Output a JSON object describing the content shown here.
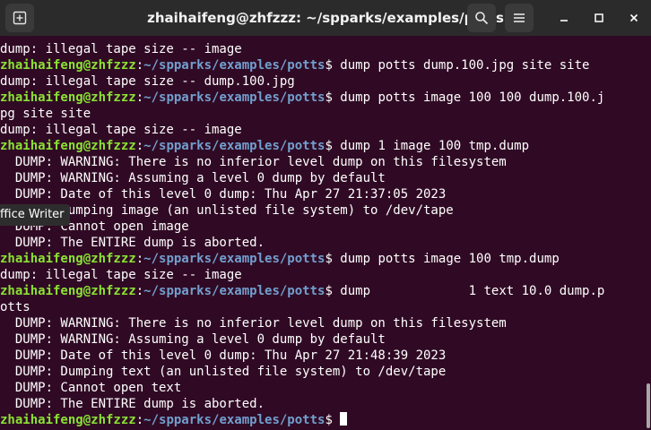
{
  "window": {
    "title": "zhaihaifeng@zhfzzz: ~/spparks/examples/potts"
  },
  "icons": {
    "new_tab": "new-tab-icon",
    "search": "search-icon",
    "menu": "hamburger-menu-icon",
    "minimize": "minimize-icon",
    "maximize": "maximize-icon",
    "close": "close-icon"
  },
  "colors": {
    "terminal_bg": "#300a24",
    "prompt_user": "#8ae234",
    "prompt_path": "#729fcf",
    "titlebar": "#2b2b2b"
  },
  "prompt": {
    "user": "zhaihaifeng@zhfzzz",
    "sep": ":",
    "path": "~/spparks/examples/potts",
    "symbol": "$"
  },
  "tooltip": {
    "text": "ffice Writer"
  },
  "terminal": {
    "lines": [
      "dump: illegal tape size -- image",
      "zhaihaifeng@zhfzzz:~/spparks/examples/potts$ dump potts dump.100.jpg site site",
      "dump: illegal tape size -- dump.100.jpg",
      "zhaihaifeng@zhfzzz:~/spparks/examples/potts$ dump potts image 100 100 dump.100.j",
      "pg site site",
      "dump: illegal tape size -- image",
      "zhaihaifeng@zhfzzz:~/spparks/examples/potts$ dump 1 image 100 tmp.dump",
      "  DUMP: WARNING: There is no inferior level dump on this filesystem",
      "  DUMP: WARNING: Assuming a level 0 dump by default",
      "  DUMP: Date of this level 0 dump: Thu Apr 27 21:37:05 2023",
      "  DUMP: Dumping image (an unlisted file system) to /dev/tape",
      "  DUMP: Cannot open image",
      "  DUMP: The ENTIRE dump is aborted.",
      "zhaihaifeng@zhfzzz:~/spparks/examples/potts$ dump potts image 100 tmp.dump",
      "dump: illegal tape size -- image",
      "zhaihaifeng@zhfzzz:~/spparks/examples/potts$ dump             1 text 10.0 dump.p",
      "otts",
      "  DUMP: WARNING: There is no inferior level dump on this filesystem",
      "  DUMP: WARNING: Assuming a level 0 dump by default",
      "  DUMP: Date of this level 0 dump: Thu Apr 27 21:48:39 2023",
      "  DUMP: Dumping text (an unlisted file system) to /dev/tape",
      "  DUMP: Cannot open text",
      "  DUMP: The ENTIRE dump is aborted.",
      "zhaihaifeng@zhfzzz:~/spparks/examples/potts$ "
    ]
  }
}
